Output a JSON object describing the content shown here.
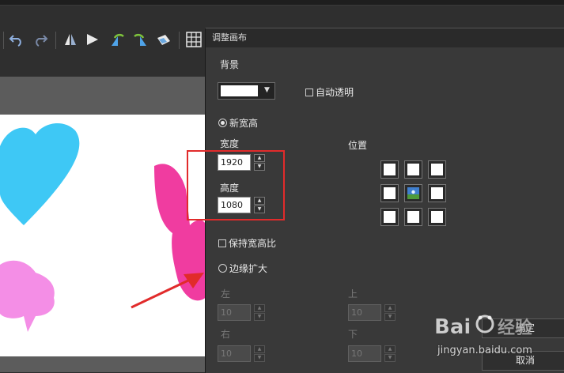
{
  "dialog": {
    "title": "调整画布",
    "background_label": "背景",
    "background_color": "#ffffff",
    "auto_transparent_label": "自动透明",
    "new_size_label": "新宽高",
    "width_label": "宽度",
    "width_value": "1920",
    "height_label": "高度",
    "height_value": "1080",
    "keep_ratio_label": "保持宽高比",
    "position_label": "位置",
    "expand_label": "边缘扩大",
    "left_label": "左",
    "left_value": "10",
    "top_label": "上",
    "top_value": "10",
    "right_label": "右",
    "right_value": "10",
    "bottom_label": "下",
    "bottom_value": "10",
    "ok_button": "确定",
    "cancel_button": "取消"
  },
  "canvas": {
    "heart_color": "#3ec8f5",
    "butterfly_color": "#f03ca0",
    "bubble_color": "#f48ee6"
  },
  "watermark": {
    "brand": "Bai",
    "brand2": "经验",
    "url": "jingyan.baidu.com"
  },
  "colors": {
    "annotation_red": "#e12b2b"
  }
}
